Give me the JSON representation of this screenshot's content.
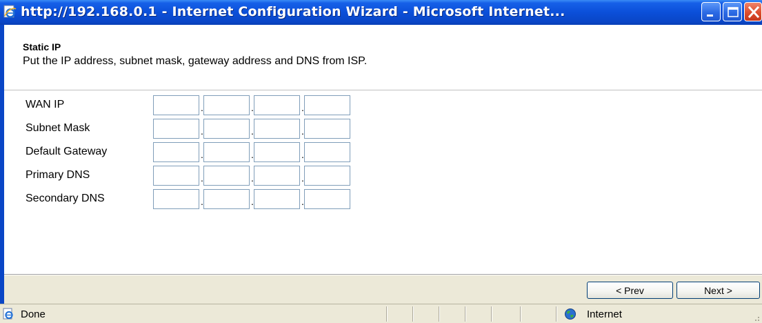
{
  "window": {
    "title": "http://192.168.0.1 - Internet Configuration Wizard - Microsoft Internet...",
    "controls": [
      "minimize",
      "maximize",
      "close"
    ],
    "title_bar_color": "#0a46c6",
    "icon": "ie-page-icon"
  },
  "header": {
    "title": "Static IP",
    "description": "Put the IP address, subnet mask, gateway address and DNS from ISP."
  },
  "form": {
    "rows": [
      {
        "label": "WAN IP",
        "octets": [
          "",
          "",
          "",
          ""
        ]
      },
      {
        "label": "Subnet Mask",
        "octets": [
          "",
          "",
          "",
          ""
        ]
      },
      {
        "label": "Default Gateway",
        "octets": [
          "",
          "",
          "",
          ""
        ]
      },
      {
        "label": "Primary DNS",
        "octets": [
          "",
          "",
          "",
          ""
        ]
      },
      {
        "label": "Secondary DNS",
        "octets": [
          "",
          "",
          "",
          ""
        ]
      }
    ],
    "separator": "."
  },
  "buttons": {
    "prev_label": "< Prev",
    "next_label": "Next >"
  },
  "statusbar": {
    "status": "Done",
    "status_icon": "ie-page-icon",
    "zone": "Internet",
    "zone_icon": "globe-icon"
  }
}
